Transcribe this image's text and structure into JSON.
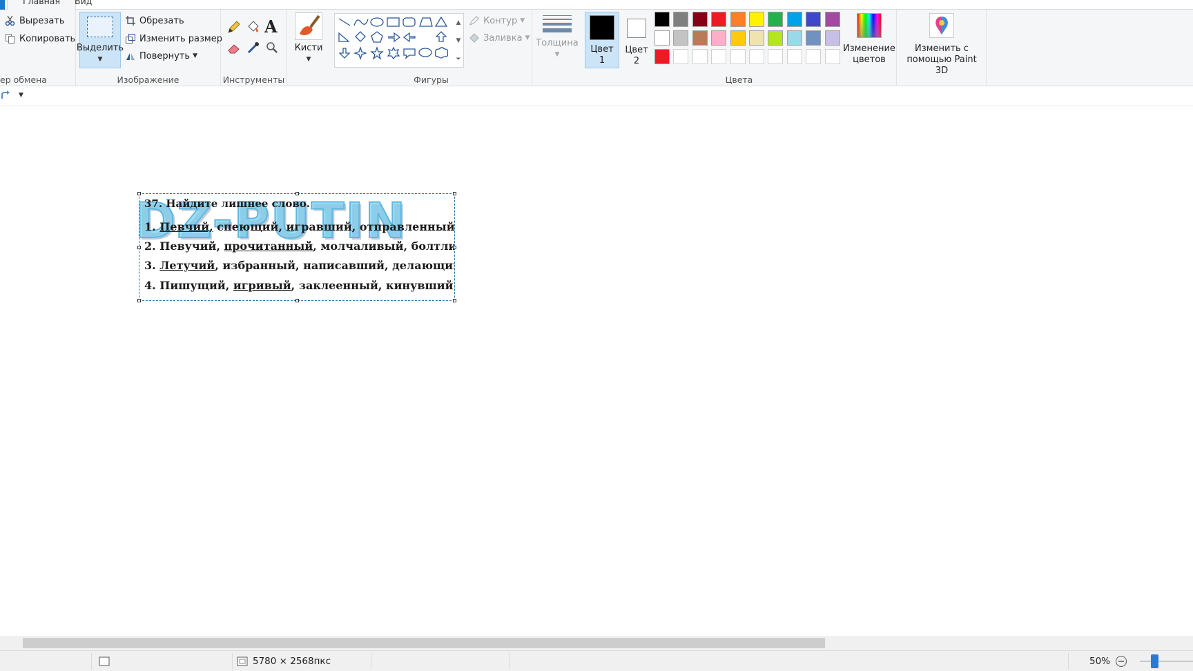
{
  "tabs": [
    {
      "label": "Главная",
      "active": true
    },
    {
      "label": "Вид",
      "active": false
    }
  ],
  "clipboard": {
    "cut_label": "Вырезать",
    "copy_label": "Копировать",
    "group_label": "ер обмена"
  },
  "image": {
    "select_label": "Выделить",
    "crop_label": "Обрезать",
    "resize_label": "Изменить размер",
    "rotate_label": "Повернуть",
    "group_label": "Изображение"
  },
  "tools": {
    "group_label": "Инструменты"
  },
  "brushes": {
    "label": "Кисти"
  },
  "shapes": {
    "outline_label": "Контур",
    "fill_label": "Заливка",
    "group_label": "Фигуры"
  },
  "size": {
    "label": "Толщина"
  },
  "colors": {
    "color1_label": "Цвет\n1",
    "color1_l1": "Цвет",
    "color1_l2": "1",
    "color2_l1": "Цвет",
    "color2_l2": "2",
    "edit_l1": "Изменение",
    "edit_l2": "цветов",
    "group_label": "Цвета",
    "color1_value": "#000000",
    "color2_value": "#ffffff",
    "palette": [
      [
        "#000000",
        "#7f7f7f",
        "#880015",
        "#ed1c24",
        "#ff7f27",
        "#fff200",
        "#22b14c",
        "#00a2e8",
        "#3f48cc",
        "#a349a4"
      ],
      [
        "#ffffff",
        "#c3c3c3",
        "#b97a57",
        "#ffaec9",
        "#ffc90e",
        "#efe4b0",
        "#b5e61d",
        "#99d9ea",
        "#7092be",
        "#c8bfe7"
      ],
      [
        "#ed1c24",
        "",
        "",
        "",
        "",
        "",
        "",
        "",
        "",
        ""
      ]
    ]
  },
  "paint3d": {
    "l1": "Изменить с",
    "l2": "помощью Paint 3D"
  },
  "document": {
    "watermark": "DZ-PUTIN",
    "title": "37. Найдите лишнее слово.",
    "rows": [
      {
        "num": "1.",
        "u": "Певчий,",
        "rest": " спеющий, игравший, отправленный"
      },
      {
        "num": "2.",
        "pre": " Певучий, ",
        "u": "прочитанный",
        "rest": ", молчаливый, болтливый"
      },
      {
        "num": "3.",
        "u": "Летучий",
        "rest": ", избранный, написавший, делающий"
      },
      {
        "num": "4.",
        "pre": " Пишущий, ",
        "u": "игривый",
        "rest": ", заклеенный, кинувший"
      }
    ]
  },
  "status": {
    "dimensions": "5780 × 2568пкс",
    "zoom": "50%"
  }
}
